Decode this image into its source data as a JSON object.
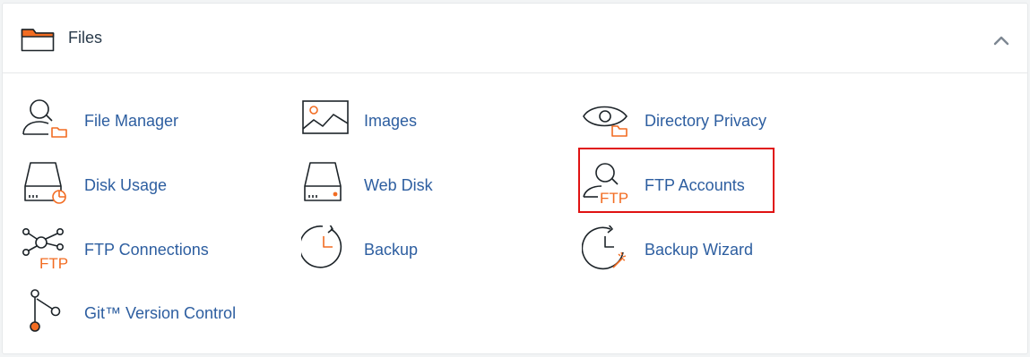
{
  "header": {
    "title": "Files",
    "icon": "folder-icon",
    "collapse_icon": "chevron-up-icon"
  },
  "colors": {
    "accent_orange": "#f26c22",
    "link_blue": "#2d5ea0",
    "icon_dark": "#1d2429",
    "highlight_red": "#e01212"
  },
  "items": [
    {
      "label": "File Manager",
      "icon": "file-manager-icon"
    },
    {
      "label": "Images",
      "icon": "images-icon"
    },
    {
      "label": "Directory Privacy",
      "icon": "directory-privacy-icon"
    },
    {
      "label": "Disk Usage",
      "icon": "disk-usage-icon"
    },
    {
      "label": "Web Disk",
      "icon": "web-disk-icon"
    },
    {
      "label": "FTP Accounts",
      "icon": "ftp-accounts-icon",
      "highlighted": true
    },
    {
      "label": "FTP Connections",
      "icon": "ftp-connections-icon"
    },
    {
      "label": "Backup",
      "icon": "backup-icon"
    },
    {
      "label": "Backup Wizard",
      "icon": "backup-wizard-icon"
    },
    {
      "label": "Git™ Version Control",
      "icon": "git-version-control-icon"
    }
  ],
  "icon_text": {
    "ftp": "FTP"
  }
}
